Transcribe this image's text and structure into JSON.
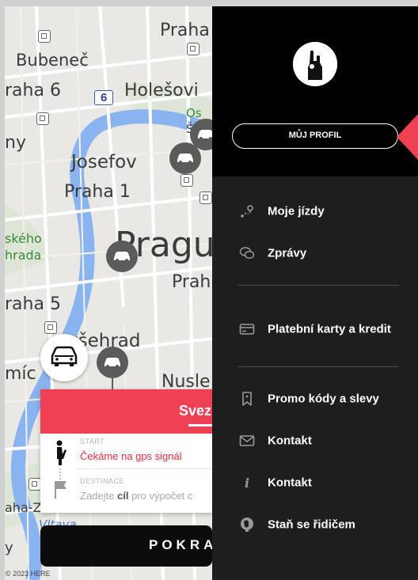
{
  "map": {
    "labels": {
      "praha_top": "Praha",
      "bubenec": "Bubeneč",
      "praha6": "raha 6",
      "holesovice": "Holešovi",
      "route6": "6",
      "os": "Os",
      "st": "Št",
      "ny": "ny",
      "josefov": "Josefov",
      "praha1": "Praha 1",
      "skeho": "ského",
      "hrada": "hrada",
      "prague": "Pragu",
      "prah": "Prah",
      "praha5": "raha 5",
      "vysehrad": "yšehrad",
      "mici": "míc",
      "nusle": "Nusle",
      "praha_z": "aha-Z",
      "vltava": "Vltava",
      "y": "y"
    },
    "copyright": "© 2023 HERE",
    "colors": {
      "water": "#8ab4f0",
      "land": "#e9e8e4",
      "park": "#dde6d6",
      "pin": "#5b5b5b"
    }
  },
  "card": {
    "title": "Svez",
    "start_label": "START",
    "start_value": "Čekáme na gps signál",
    "destination_label": "DESTINACE",
    "destination_prefix": "Zadejte ",
    "destination_bold": "cíl",
    "destination_suffix": " pro výpočet c",
    "accent": "#ef4054"
  },
  "continue_button": "POKRA",
  "drawer": {
    "logo_icon": "raised-hand-icon",
    "profile_button": "MŮJ PROFIL",
    "items": [
      {
        "label": "Moje jízdy",
        "icon": "route-pin-icon"
      },
      {
        "label": "Zprávy",
        "icon": "chat-icon"
      },
      {
        "label": "Platební karty a kredit",
        "icon": "card-icon"
      },
      {
        "label": "Promo kódy a slevy",
        "icon": "bookmark-icon"
      },
      {
        "label": "Kontakt",
        "icon": "mail-icon"
      },
      {
        "label": "Kontakt",
        "icon": "info-icon"
      },
      {
        "label": "Staň se řidičem",
        "icon": "driver-icon"
      }
    ],
    "colors": {
      "top": "#000000",
      "body": "#1e1e1e",
      "pointer": "#ef4054"
    }
  }
}
